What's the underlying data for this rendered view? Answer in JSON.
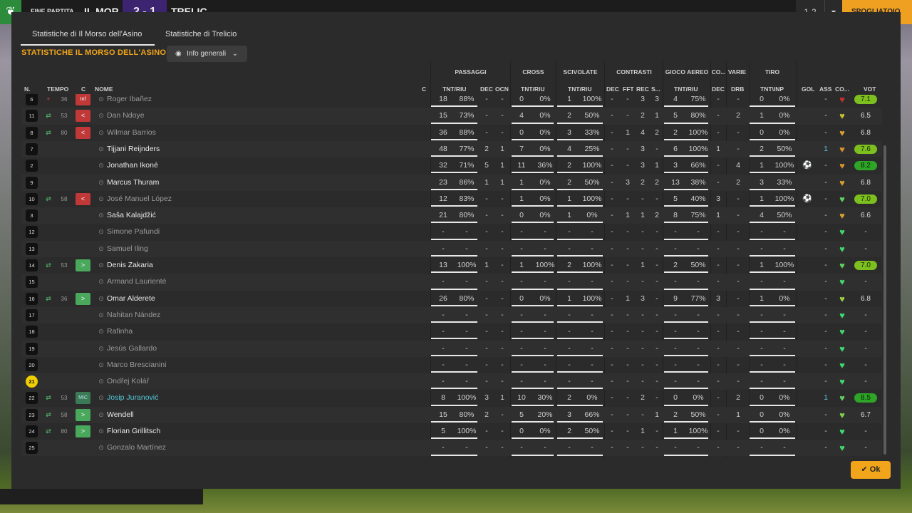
{
  "topbar": {
    "logo": "❦",
    "title": "FINE PARTITA",
    "team1": "IL MOR",
    "score": "2 - 1",
    "team2": "TRELIC",
    "r1": "1-2",
    "r2": "▾",
    "r3": "SPOGLIATOIO"
  },
  "tabs": [
    {
      "label": "Statistiche di Il Morso dell'Asino",
      "active": true
    },
    {
      "label": "Statistiche di Trelicio",
      "active": false
    }
  ],
  "section_title": "STATISTICHE IL MORSO DELL'ASINO",
  "dropdown": {
    "label": "Info generali",
    "icon": "eye-icon"
  },
  "groups": [
    "PASSAGGI",
    "CROSS",
    "SCIVOLATE",
    "CONTRASTI",
    "GIOCO AEREO",
    "CO...",
    "VARIE",
    "TIRO"
  ],
  "headers": {
    "n": "N.",
    "tempo": "TEMPO",
    "c": "C",
    "nome": "NOME",
    "c2": "C",
    "pass_tnt": "TNT/RIU",
    "pass_dec": "DEC",
    "pass_ocn": "OCN",
    "cross_tnt": "TNT/RIU",
    "sciv_tnt": "TNT/RIU",
    "con_dec": "DEC",
    "con_fft": "FFT",
    "con_rec": "REC",
    "con_s": "S...",
    "aereo_tnt": "TNT/RIU",
    "co_dec": "DEC",
    "varie_drb": "DRB",
    "tiro_tnt": "TNT\\INP",
    "gol": "GOL",
    "ass": "ASS",
    "cond": "CO...",
    "vot": "VOT"
  },
  "players": [
    {
      "n": "6",
      "ev": "+",
      "tempo": "36",
      "c": "Inf",
      "name": "Roger Ibañez",
      "style": "dim",
      "p": [
        "18",
        "88%",
        "-",
        "-"
      ],
      "p_fill": 0.88,
      "cr": [
        "0",
        "0%"
      ],
      "cr_fill": 0.0,
      "sc": [
        "1",
        "100%"
      ],
      "sc_fill": 1.0,
      "con": [
        "-",
        "-",
        "3",
        "3"
      ],
      "ae": [
        "4",
        "75%"
      ],
      "ae_fill": 0.75,
      "cod": "-",
      "drb": "-",
      "ti": [
        "0",
        "0%"
      ],
      "ti_fill": 0.0,
      "gol": "",
      "ass": "-",
      "heart": "#c83030",
      "vot": "7.1",
      "vclass": "green"
    },
    {
      "n": "11",
      "ev": "⇄",
      "tempo": "53",
      "c": "<",
      "name": "Dan Ndoye",
      "style": "dim",
      "p": [
        "15",
        "73%",
        "-",
        "-"
      ],
      "p_fill": 0.73,
      "cr": [
        "4",
        "0%"
      ],
      "cr_fill": 0.0,
      "sc": [
        "2",
        "50%"
      ],
      "sc_fill": 0.5,
      "con": [
        "-",
        "-",
        "2",
        "1"
      ],
      "ae": [
        "5",
        "80%"
      ],
      "ae_fill": 0.8,
      "cod": "-",
      "drb": "2",
      "ti": [
        "1",
        "0%"
      ],
      "ti_fill": 0.0,
      "gol": "",
      "ass": "-",
      "heart": "#c8c030",
      "vot": "6.5",
      "vclass": ""
    },
    {
      "n": "8",
      "ev": "⇄",
      "tempo": "80",
      "c": "<",
      "name": "Wilmar Barrios",
      "style": "dim",
      "p": [
        "36",
        "88%",
        "-",
        "-"
      ],
      "p_fill": 0.88,
      "cr": [
        "0",
        "0%"
      ],
      "cr_fill": 0.0,
      "sc": [
        "3",
        "33%"
      ],
      "sc_fill": 0.33,
      "con": [
        "-",
        "1",
        "4",
        "2"
      ],
      "ae": [
        "2",
        "100%"
      ],
      "ae_fill": 1.0,
      "cod": "-",
      "drb": "-",
      "ti": [
        "0",
        "0%"
      ],
      "ti_fill": 0.0,
      "gol": "",
      "ass": "-",
      "heart": "#d8a030",
      "vot": "6.8",
      "vclass": ""
    },
    {
      "n": "7",
      "ev": "",
      "tempo": "",
      "c": "",
      "name": "Tijjani Reijnders",
      "style": "",
      "p": [
        "48",
        "77%",
        "2",
        "1"
      ],
      "p_fill": 0.77,
      "cr": [
        "7",
        "0%"
      ],
      "cr_fill": 0.0,
      "sc": [
        "4",
        "25%"
      ],
      "sc_fill": 0.25,
      "con": [
        "-",
        "-",
        "3",
        "-"
      ],
      "ae": [
        "6",
        "100%"
      ],
      "ae_fill": 1.0,
      "cod": "1",
      "drb": "-",
      "ti": [
        "2",
        "50%"
      ],
      "ti_fill": 0.5,
      "gol": "",
      "ass": "1",
      "heart": "#d89030",
      "vot": "7.6",
      "vclass": "green"
    },
    {
      "n": "2",
      "ev": "",
      "tempo": "",
      "c": "",
      "name": "Jonathan Ikoné",
      "style": "",
      "p": [
        "32",
        "71%",
        "5",
        "1"
      ],
      "p_fill": 0.71,
      "cr": [
        "11",
        "36%"
      ],
      "cr_fill": 0.36,
      "sc": [
        "2",
        "100%"
      ],
      "sc_fill": 1.0,
      "con": [
        "-",
        "-",
        "3",
        "1"
      ],
      "ae": [
        "3",
        "66%"
      ],
      "ae_fill": 0.66,
      "cod": "-",
      "drb": "4",
      "ti": [
        "1",
        "100%"
      ],
      "ti_fill": 1.0,
      "gol": "⚽",
      "ass": "-",
      "heart": "#d89030",
      "vot": "8.2",
      "vclass": "dark"
    },
    {
      "n": "9",
      "ev": "",
      "tempo": "",
      "c": "",
      "name": "Marcus Thuram",
      "style": "",
      "p": [
        "23",
        "86%",
        "1",
        "1"
      ],
      "p_fill": 0.86,
      "cr": [
        "1",
        "0%"
      ],
      "cr_fill": 0.0,
      "sc": [
        "2",
        "50%"
      ],
      "sc_fill": 0.5,
      "con": [
        "-",
        "3",
        "2",
        "2"
      ],
      "ae": [
        "13",
        "38%"
      ],
      "ae_fill": 0.38,
      "cod": "-",
      "drb": "2",
      "ti": [
        "3",
        "33%"
      ],
      "ti_fill": 0.33,
      "gol": "",
      "ass": "-",
      "heart": "#d8a030",
      "vot": "6.8",
      "vclass": ""
    },
    {
      "n": "10",
      "ev": "⇄",
      "tempo": "58",
      "c": "<",
      "name": "José Manuel López",
      "style": "dim",
      "p": [
        "12",
        "83%",
        "-",
        "-"
      ],
      "p_fill": 0.83,
      "cr": [
        "1",
        "0%"
      ],
      "cr_fill": 0.0,
      "sc": [
        "1",
        "100%"
      ],
      "sc_fill": 1.0,
      "con": [
        "-",
        "-",
        "-",
        "-"
      ],
      "ae": [
        "5",
        "40%"
      ],
      "ae_fill": 0.4,
      "cod": "3",
      "drb": "-",
      "ti": [
        "1",
        "100%"
      ],
      "ti_fill": 1.0,
      "gol": "⚽",
      "ass": "-",
      "heart": "#60d060",
      "vot": "7.0",
      "vclass": "green"
    },
    {
      "n": "3",
      "ev": "",
      "tempo": "",
      "c": "",
      "name": "Saša Kalajdžić",
      "style": "",
      "p": [
        "21",
        "80%",
        "-",
        "-"
      ],
      "p_fill": 0.8,
      "cr": [
        "0",
        "0%"
      ],
      "cr_fill": 0.0,
      "sc": [
        "1",
        "0%"
      ],
      "sc_fill": 0.0,
      "con": [
        "-",
        "1",
        "1",
        "2"
      ],
      "ae": [
        "8",
        "75%"
      ],
      "ae_fill": 0.75,
      "cod": "1",
      "drb": "-",
      "ti": [
        "4",
        "50%"
      ],
      "ti_fill": 0.5,
      "gol": "",
      "ass": "-",
      "heart": "#d8a030",
      "vot": "6.6",
      "vclass": ""
    },
    {
      "n": "12",
      "ev": "",
      "tempo": "",
      "c": "",
      "name": "Simone Pafundi",
      "style": "dim",
      "p": [
        "-",
        "-",
        "-",
        "-"
      ],
      "p_fill": 0,
      "cr": [
        "-",
        "-"
      ],
      "cr_fill": 0,
      "sc": [
        "-",
        "-"
      ],
      "sc_fill": 0,
      "con": [
        "-",
        "-",
        "-",
        "-"
      ],
      "ae": [
        "-",
        "-"
      ],
      "ae_fill": 0,
      "cod": "-",
      "drb": "-",
      "ti": [
        "-",
        "-"
      ],
      "ti_fill": 0,
      "gol": "",
      "ass": "-",
      "heart": "#40d870",
      "vot": "-",
      "vclass": ""
    },
    {
      "n": "13",
      "ev": "",
      "tempo": "",
      "c": "",
      "name": "Samuel Iling",
      "style": "dim",
      "p": [
        "-",
        "-",
        "-",
        "-"
      ],
      "p_fill": 0,
      "cr": [
        "-",
        "-"
      ],
      "cr_fill": 0,
      "sc": [
        "-",
        "-"
      ],
      "sc_fill": 0,
      "con": [
        "-",
        "-",
        "-",
        "-"
      ],
      "ae": [
        "-",
        "-"
      ],
      "ae_fill": 0,
      "cod": "-",
      "drb": "-",
      "ti": [
        "-",
        "-"
      ],
      "ti_fill": 0,
      "gol": "",
      "ass": "-",
      "heart": "#40d870",
      "vot": "-",
      "vclass": ""
    },
    {
      "n": "14",
      "ev": "⇄",
      "tempo": "53",
      "c": ">",
      "name": "Denis Zakaria",
      "style": "",
      "p": [
        "13",
        "100%",
        "1",
        "-"
      ],
      "p_fill": 1.0,
      "cr": [
        "1",
        "100%"
      ],
      "cr_fill": 1.0,
      "sc": [
        "2",
        "100%"
      ],
      "sc_fill": 1.0,
      "con": [
        "-",
        "-",
        "1",
        "-"
      ],
      "ae": [
        "2",
        "50%"
      ],
      "ae_fill": 0.5,
      "cod": "-",
      "drb": "-",
      "ti": [
        "1",
        "100%"
      ],
      "ti_fill": 1.0,
      "gol": "",
      "ass": "-",
      "heart": "#60d060",
      "vot": "7.0",
      "vclass": "green"
    },
    {
      "n": "15",
      "ev": "",
      "tempo": "",
      "c": "",
      "name": "Armand Laurienté",
      "style": "dim",
      "p": [
        "-",
        "-",
        "-",
        "-"
      ],
      "p_fill": 0,
      "cr": [
        "-",
        "-"
      ],
      "cr_fill": 0,
      "sc": [
        "-",
        "-"
      ],
      "sc_fill": 0,
      "con": [
        "-",
        "-",
        "-",
        "-"
      ],
      "ae": [
        "-",
        "-"
      ],
      "ae_fill": 0,
      "cod": "-",
      "drb": "-",
      "ti": [
        "-",
        "-"
      ],
      "ti_fill": 0,
      "gol": "",
      "ass": "-",
      "heart": "#40d870",
      "vot": "-",
      "vclass": ""
    },
    {
      "n": "16",
      "ev": "⇄",
      "tempo": "36",
      "c": ">",
      "name": "Omar Alderete",
      "style": "",
      "p": [
        "26",
        "80%",
        "-",
        "-"
      ],
      "p_fill": 0.8,
      "cr": [
        "0",
        "0%"
      ],
      "cr_fill": 0.0,
      "sc": [
        "1",
        "100%"
      ],
      "sc_fill": 1.0,
      "con": [
        "-",
        "1",
        "3",
        "-"
      ],
      "ae": [
        "9",
        "77%"
      ],
      "ae_fill": 0.77,
      "cod": "3",
      "drb": "-",
      "ti": [
        "1",
        "0%"
      ],
      "ti_fill": 0.0,
      "gol": "",
      "ass": "-",
      "heart": "#a0d040",
      "vot": "6.8",
      "vclass": ""
    },
    {
      "n": "17",
      "ev": "",
      "tempo": "",
      "c": "",
      "name": "Nahitan Nández",
      "style": "dim",
      "p": [
        "-",
        "-",
        "-",
        "-"
      ],
      "p_fill": 0,
      "cr": [
        "-",
        "-"
      ],
      "cr_fill": 0,
      "sc": [
        "-",
        "-"
      ],
      "sc_fill": 0,
      "con": [
        "-",
        "-",
        "-",
        "-"
      ],
      "ae": [
        "-",
        "-"
      ],
      "ae_fill": 0,
      "cod": "-",
      "drb": "-",
      "ti": [
        "-",
        "-"
      ],
      "ti_fill": 0,
      "gol": "",
      "ass": "-",
      "heart": "#40d870",
      "vot": "-",
      "vclass": ""
    },
    {
      "n": "18",
      "ev": "",
      "tempo": "",
      "c": "",
      "name": "Rafinha",
      "style": "dim",
      "p": [
        "-",
        "-",
        "-",
        "-"
      ],
      "p_fill": 0,
      "cr": [
        "-",
        "-"
      ],
      "cr_fill": 0,
      "sc": [
        "-",
        "-"
      ],
      "sc_fill": 0,
      "con": [
        "-",
        "-",
        "-",
        "-"
      ],
      "ae": [
        "-",
        "-"
      ],
      "ae_fill": 0,
      "cod": "-",
      "drb": "-",
      "ti": [
        "-",
        "-"
      ],
      "ti_fill": 0,
      "gol": "",
      "ass": "-",
      "heart": "#40d870",
      "vot": "-",
      "vclass": ""
    },
    {
      "n": "19",
      "ev": "",
      "tempo": "",
      "c": "",
      "name": "Jesús Gallardo",
      "style": "dim",
      "p": [
        "-",
        "-",
        "-",
        "-"
      ],
      "p_fill": 0,
      "cr": [
        "-",
        "-"
      ],
      "cr_fill": 0,
      "sc": [
        "-",
        "-"
      ],
      "sc_fill": 0,
      "con": [
        "-",
        "-",
        "-",
        "-"
      ],
      "ae": [
        "-",
        "-"
      ],
      "ae_fill": 0,
      "cod": "-",
      "drb": "-",
      "ti": [
        "-",
        "-"
      ],
      "ti_fill": 0,
      "gol": "",
      "ass": "-",
      "heart": "#40d870",
      "vot": "-",
      "vclass": ""
    },
    {
      "n": "20",
      "ev": "",
      "tempo": "",
      "c": "",
      "name": "Marco Brescianini",
      "style": "dim",
      "p": [
        "-",
        "-",
        "-",
        "-"
      ],
      "p_fill": 0,
      "cr": [
        "-",
        "-"
      ],
      "cr_fill": 0,
      "sc": [
        "-",
        "-"
      ],
      "sc_fill": 0,
      "con": [
        "-",
        "-",
        "-",
        "-"
      ],
      "ae": [
        "-",
        "-"
      ],
      "ae_fill": 0,
      "cod": "-",
      "drb": "-",
      "ti": [
        "-",
        "-"
      ],
      "ti_fill": 0,
      "gol": "",
      "ass": "-",
      "heart": "#40d870",
      "vot": "-",
      "vclass": ""
    },
    {
      "n": "21",
      "ev": "",
      "tempo": "",
      "c": "",
      "name": "Ondřej Kolář",
      "style": "dim",
      "gk": true,
      "p": [
        "-",
        "-",
        "-",
        "-"
      ],
      "p_fill": 0,
      "cr": [
        "-",
        "-"
      ],
      "cr_fill": 0,
      "sc": [
        "-",
        "-"
      ],
      "sc_fill": 0,
      "con": [
        "-",
        "-",
        "-",
        "-"
      ],
      "ae": [
        "-",
        "-"
      ],
      "ae_fill": 0,
      "cod": "-",
      "drb": "-",
      "ti": [
        "-",
        "-"
      ],
      "ti_fill": 0,
      "gol": "",
      "ass": "-",
      "heart": "#40d870",
      "vot": "-",
      "vclass": ""
    },
    {
      "n": "22",
      "ev": "⇄",
      "tempo": "53",
      "c": "MIC",
      "name": "Josip Juranović",
      "style": "cyan",
      "p": [
        "8",
        "100%",
        "3",
        "1"
      ],
      "p_fill": 1.0,
      "cr": [
        "10",
        "30%"
      ],
      "cr_fill": 0.3,
      "sc": [
        "2",
        "0%"
      ],
      "sc_fill": 0.0,
      "con": [
        "-",
        "-",
        "2",
        "-"
      ],
      "ae": [
        "0",
        "0%"
      ],
      "ae_fill": 0.0,
      "cod": "-",
      "drb": "2",
      "ti": [
        "0",
        "0%"
      ],
      "ti_fill": 0.0,
      "gol": "",
      "ass": "1",
      "heart": "#60d060",
      "vot": "8.5",
      "vclass": "dark"
    },
    {
      "n": "23",
      "ev": "⇄",
      "tempo": "58",
      "c": ">",
      "name": "Wendell",
      "style": "",
      "p": [
        "15",
        "80%",
        "2",
        "-"
      ],
      "p_fill": 0.8,
      "cr": [
        "5",
        "20%"
      ],
      "cr_fill": 0.2,
      "sc": [
        "3",
        "66%"
      ],
      "sc_fill": 0.66,
      "con": [
        "-",
        "-",
        "-",
        "1"
      ],
      "ae": [
        "2",
        "50%"
      ],
      "ae_fill": 0.5,
      "cod": "-",
      "drb": "1",
      "ti": [
        "0",
        "0%"
      ],
      "ti_fill": 0.0,
      "gol": "",
      "ass": "-",
      "heart": "#80d050",
      "vot": "6.7",
      "vclass": ""
    },
    {
      "n": "24",
      "ev": "⇄",
      "tempo": "80",
      "c": ">",
      "name": "Florian Grillitsch",
      "style": "",
      "p": [
        "5",
        "100%",
        "-",
        "-"
      ],
      "p_fill": 1.0,
      "cr": [
        "0",
        "0%"
      ],
      "cr_fill": 0.0,
      "sc": [
        "2",
        "50%"
      ],
      "sc_fill": 0.5,
      "con": [
        "-",
        "-",
        "1",
        "-"
      ],
      "ae": [
        "1",
        "100%"
      ],
      "ae_fill": 1.0,
      "cod": "-",
      "drb": "-",
      "ti": [
        "0",
        "0%"
      ],
      "ti_fill": 0.0,
      "gol": "",
      "ass": "-",
      "heart": "#40d870",
      "vot": "-",
      "vclass": ""
    },
    {
      "n": "25",
      "ev": "",
      "tempo": "",
      "c": "",
      "name": "Gonzalo Martínez",
      "style": "dim",
      "p": [
        "-",
        "-",
        "-",
        "-"
      ],
      "p_fill": 0,
      "cr": [
        "-",
        "-"
      ],
      "cr_fill": 0,
      "sc": [
        "-",
        "-"
      ],
      "sc_fill": 0,
      "con": [
        "-",
        "-",
        "-",
        "-"
      ],
      "ae": [
        "-",
        "-"
      ],
      "ae_fill": 0,
      "cod": "-",
      "drb": "-",
      "ti": [
        "-",
        "-"
      ],
      "ti_fill": 0,
      "gol": "",
      "ass": "-",
      "heart": "#40d870",
      "vot": "-",
      "vclass": ""
    }
  ],
  "ok_label": "Ok",
  "ok_icon": "check-icon"
}
